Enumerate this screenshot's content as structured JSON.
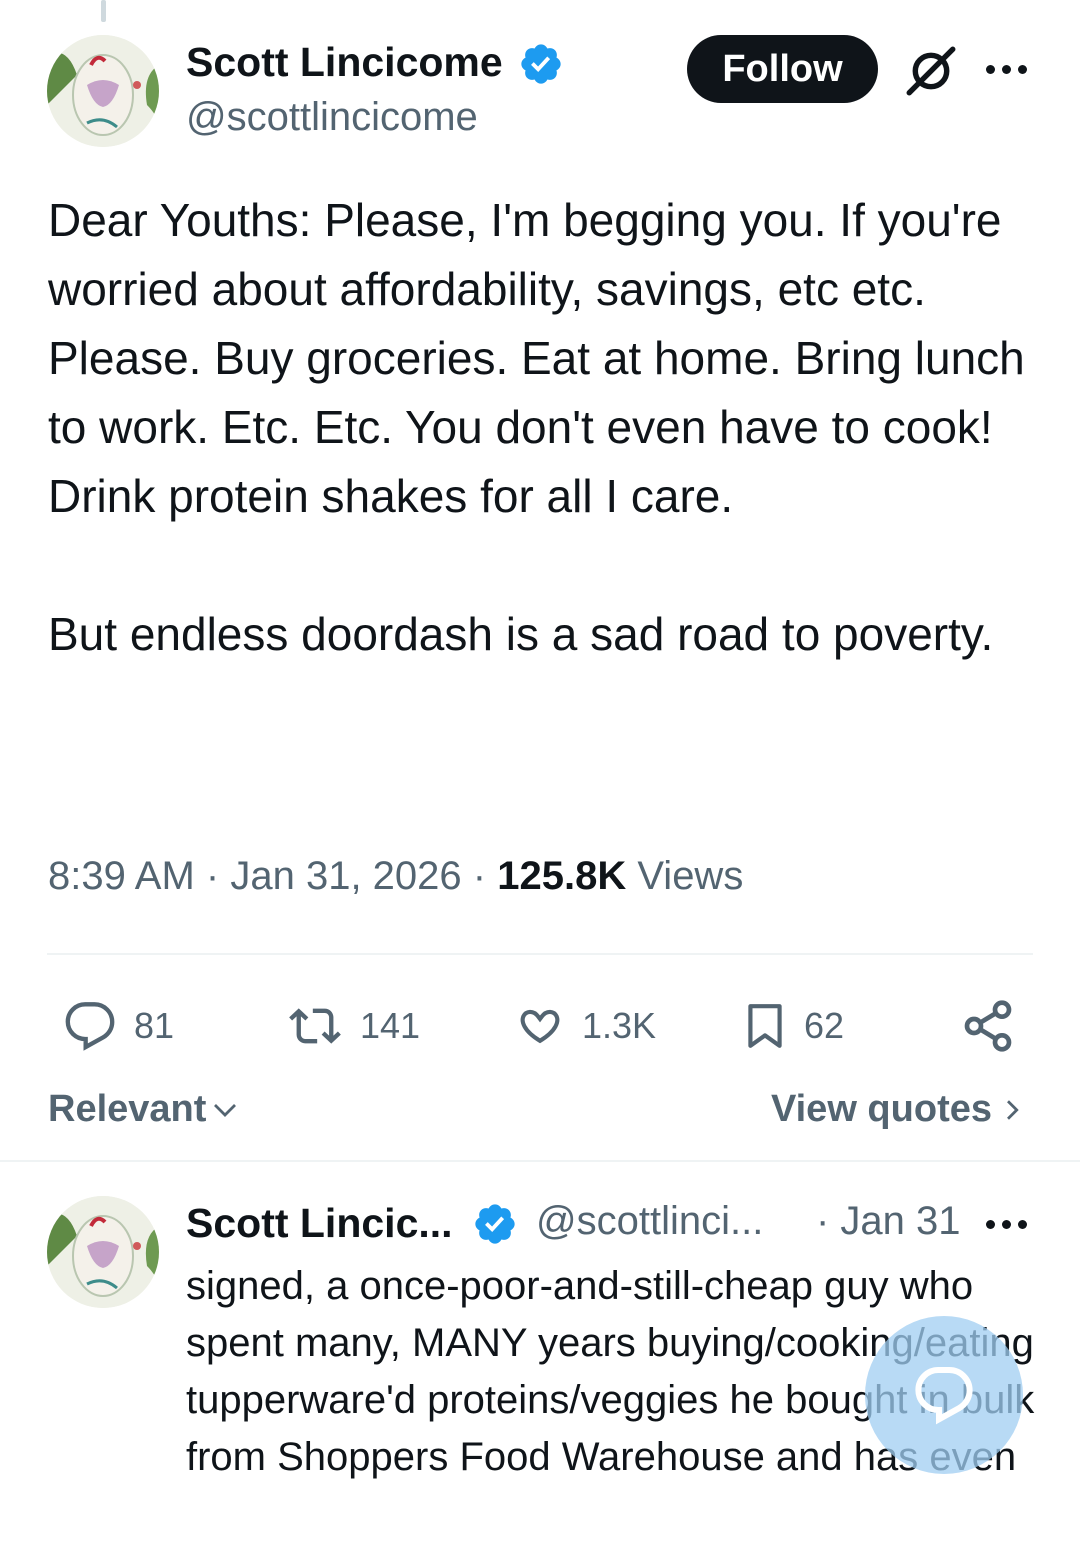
{
  "tweet": {
    "author_name": "Scott Lincicome",
    "handle": "@scottlincicome",
    "follow_label": "Follow",
    "text": "Dear Youths: Please, I'm begging you. If you're worried about affordability, savings, etc etc. Please. Buy groceries. Eat at home. Bring lunch to work. Etc. Etc. You don't even have to cook! Drink protein shakes for all I care.\n\nBut endless doordash is a sad road to poverty.",
    "time": "8:39 AM",
    "date": "Jan 31, 2026",
    "views_count": "125.8K",
    "views_label": "Views",
    "separator": "·"
  },
  "actions": {
    "replies": "81",
    "reposts": "141",
    "likes": "1.3K",
    "bookmarks": "62"
  },
  "sort": {
    "label": "Relevant",
    "view_quotes": "View quotes"
  },
  "reply": {
    "author_name": "Scott Lincic...",
    "handle": "@scottlinci...",
    "date": "· Jan 31",
    "text": "signed, a once-poor-and-still-cheap guy who spent many, MANY years buying/cooking/eating tupperware'd proteins/veggies he bought in bulk from Shoppers Food Warehouse and has even"
  },
  "colors": {
    "verified": "#1d9bf0",
    "secondary_text": "#536471",
    "fab": "#a0cef2"
  },
  "icons": [
    "verified-badge-icon",
    "grok-icon",
    "more-icon",
    "reply-icon",
    "repost-icon",
    "like-icon",
    "bookmark-icon",
    "share-icon",
    "chevron-down-icon",
    "chevron-right-icon",
    "compose-reply-icon"
  ]
}
